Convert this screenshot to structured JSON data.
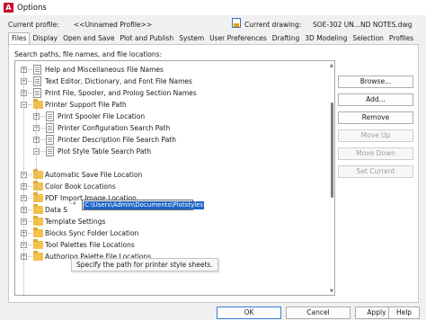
{
  "window": {
    "title": "Options",
    "icon": "autocad-a-icon"
  },
  "profile": {
    "current_profile_label": "Current profile:",
    "current_profile_value": "<<Unnamed Profile>>",
    "current_drawing_label": "Current drawing:",
    "current_drawing_value": "SOE-302 UN...ND NOTES.dwg"
  },
  "tabs": [
    "Files",
    "Display",
    "Open and Save",
    "Plot and Publish",
    "System",
    "User Preferences",
    "Drafting",
    "3D Modeling",
    "Selection",
    "Profiles"
  ],
  "active_tab": "Files",
  "panel": {
    "caption": "Search paths, file names, and file locations:",
    "tree": [
      {
        "label": "Help and Miscellaneous File Names",
        "level": 0,
        "expander": "+",
        "icon": "document-icon"
      },
      {
        "label": "Text Editor, Dictionary, and Font File Names",
        "level": 0,
        "expander": "+",
        "icon": "document-icon"
      },
      {
        "label": "Print File, Spooler, and Prolog Section Names",
        "level": 0,
        "expander": "+",
        "icon": "document-icon"
      },
      {
        "label": "Printer Support File Path",
        "level": 0,
        "expander": "−",
        "icon": "folder-icon"
      },
      {
        "label": "Print Spooler File Location",
        "level": 1,
        "expander": "+",
        "icon": "document-icon"
      },
      {
        "label": "Printer Configuration Search Path",
        "level": 1,
        "expander": "+",
        "icon": "document-icon"
      },
      {
        "label": "Printer Description File Search Path",
        "level": 1,
        "expander": "+",
        "icon": "document-icon"
      },
      {
        "label": "Plot Style Table Search Path",
        "level": 1,
        "expander": "−",
        "icon": "document-icon"
      },
      {
        "label": "Automatic Save File Location",
        "level": 0,
        "expander": "+",
        "icon": "folder-icon"
      },
      {
        "label": "Color Book Locations",
        "level": 0,
        "expander": "+",
        "icon": "folder-icon"
      },
      {
        "label": "PDF Import Image Location",
        "level": 0,
        "expander": "+",
        "icon": "folder-icon"
      },
      {
        "label": "Data S",
        "level": 0,
        "expander": "+",
        "icon": "folder-icon"
      },
      {
        "label": "Template Settings",
        "level": 0,
        "expander": "+",
        "icon": "folder-icon"
      },
      {
        "label": "Blocks Sync Folder Location",
        "level": 0,
        "expander": "+",
        "icon": "folder-icon"
      },
      {
        "label": "Tool Palettes File Locations",
        "level": 0,
        "expander": "+",
        "icon": "folder-icon"
      },
      {
        "label": "Authoring Palette File Locations",
        "level": 0,
        "expander": "+",
        "icon": "folder-icon"
      }
    ],
    "edit_path": "C:\\Users\\Admin\\Documents\\Plotstyles",
    "tooltip": "Specify the path for printer style sheets."
  },
  "side_buttons": [
    {
      "label": "Browse...",
      "enabled": true
    },
    {
      "label": "Add...",
      "enabled": true
    },
    {
      "label": "Remove",
      "enabled": true
    },
    {
      "label": "Move Up",
      "enabled": false
    },
    {
      "label": "Move Down",
      "enabled": false
    },
    {
      "label": "Set Current",
      "enabled": false
    }
  ],
  "bottom_buttons": {
    "ok": "OK",
    "cancel": "Cancel",
    "apply": "Apply",
    "help": "Help"
  }
}
